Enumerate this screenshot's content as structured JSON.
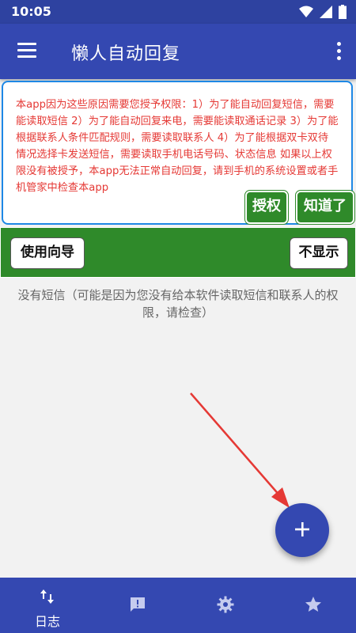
{
  "status_bar": {
    "time": "10:05"
  },
  "app_bar": {
    "title": "懒人自动回复"
  },
  "permission_notice": {
    "message": "本app因为这些原因需要您授予权限：1）为了能自动回复短信，需要能读取短信 2）为了能自动回复来电，需要能读取通话记录 3）为了能根据联系人条件匹配规则，需要读取联系人 4）为了能根据双卡双待情况选择卡发送短信，需要读取手机电话号码、状态信息 如果以上权限没有被授予，本app无法正常自动回复，请到手机的系统设置或者手机管家中检查本app",
    "authorize_label": "授权",
    "got_it_label": "知道了"
  },
  "guide_bar": {
    "guide_label": "使用向导",
    "hide_label": "不显示"
  },
  "empty_message": "没有短信（可能是因为您没有给本软件读取短信和联系人的权限，请检查）",
  "fab": {
    "icon": "plus-icon"
  },
  "bottom_nav": {
    "items": [
      {
        "label": "日志",
        "icon": "swap-vertical-icon",
        "active": true
      },
      {
        "label": "",
        "icon": "feedback-icon"
      },
      {
        "label": "",
        "icon": "gear-icon"
      },
      {
        "label": "",
        "icon": "star-icon"
      }
    ]
  },
  "colors": {
    "primary": "#3448b1",
    "status_bar": "#2e42a0",
    "accent_green": "#2f8a2a",
    "warning_text": "#e53935",
    "annotation_arrow": "#e53935"
  }
}
